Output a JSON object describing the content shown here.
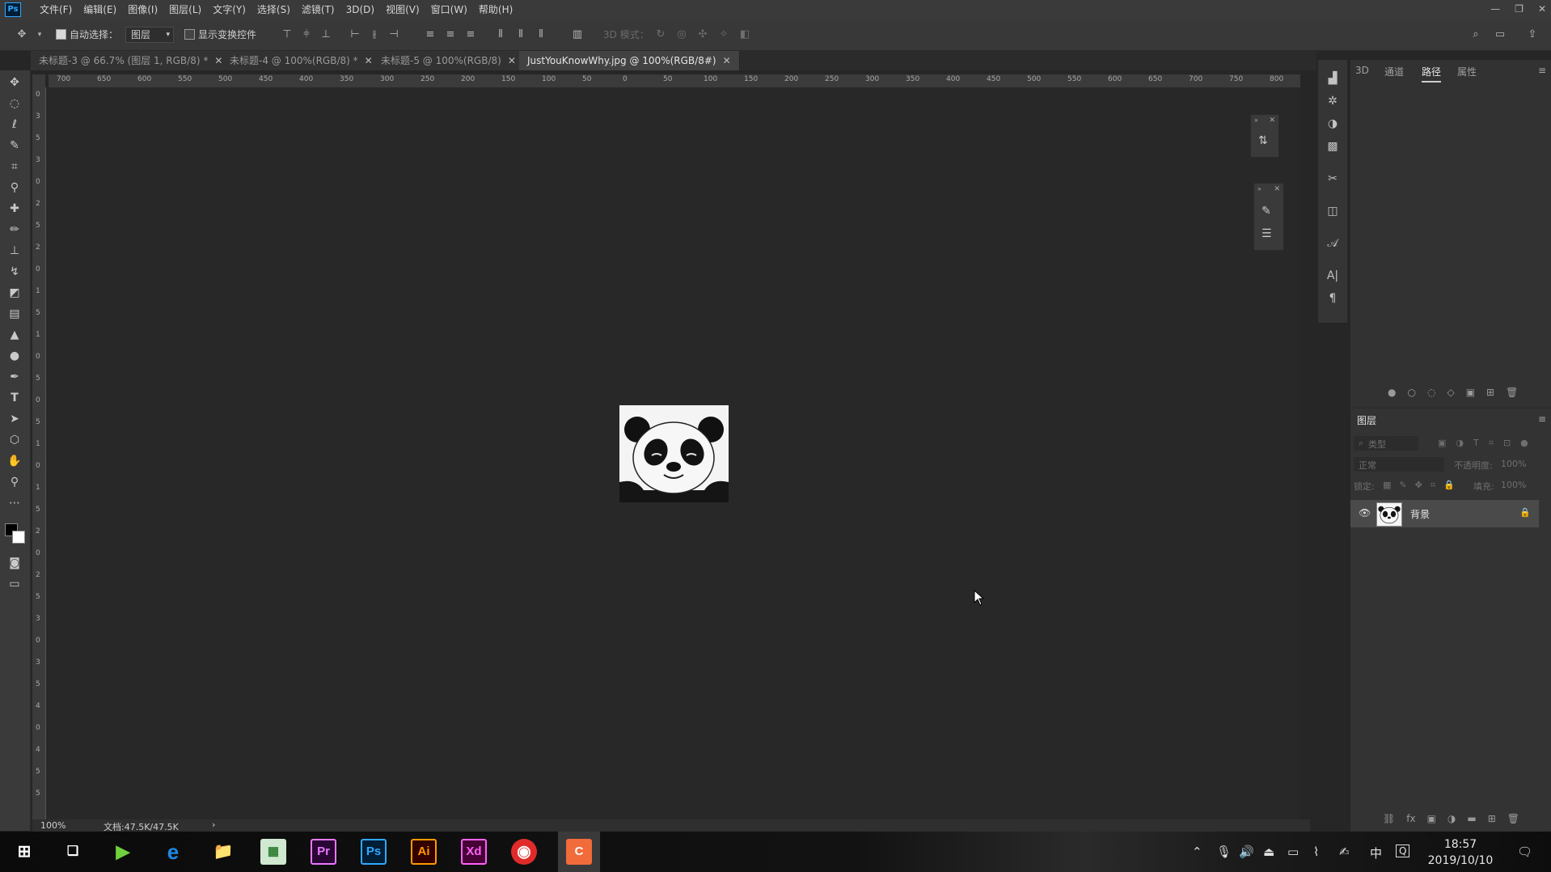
{
  "menubar": {
    "logo": "Ps",
    "items": [
      "文件(F)",
      "编辑(E)",
      "图像(I)",
      "图层(L)",
      "文字(Y)",
      "选择(S)",
      "滤镜(T)",
      "3D(D)",
      "视图(V)",
      "窗口(W)",
      "帮助(H)"
    ],
    "controls": [
      "—",
      "❐",
      "✕"
    ]
  },
  "options": {
    "auto_select_label": "自动选择：",
    "auto_select_checked": true,
    "auto_select_target": "图层",
    "show_transform_label": "显示变换控件",
    "show_transform_checked": false,
    "mode3d_label": "3D 模式："
  },
  "tabs": [
    {
      "label": "未标题-3 @ 66.7% (图层 1, RGB/8) *",
      "active": false
    },
    {
      "label": "未标题-4 @ 100%(RGB/8) *",
      "active": false
    },
    {
      "label": "未标题-5 @ 100%(RGB/8)",
      "active": false
    },
    {
      "label": "JustYouKnowWhy.jpg @ 100%(RGB/8#)",
      "active": true
    }
  ],
  "ruler": {
    "h_ticks": [
      "700",
      "650",
      "600",
      "550",
      "500",
      "450",
      "400",
      "350",
      "300",
      "250",
      "200",
      "150",
      "100",
      "50",
      "0",
      "50",
      "100",
      "150",
      "200",
      "250",
      "300",
      "350",
      "400",
      "450",
      "500",
      "550",
      "600",
      "650",
      "700",
      "750",
      "800"
    ],
    "v_ticks": [
      "0",
      "3",
      "5",
      "3",
      "0",
      "2",
      "5",
      "2",
      "0",
      "1",
      "5",
      "1",
      "0",
      "5",
      "0",
      "5",
      "1",
      "0",
      "1",
      "5",
      "2",
      "0",
      "2",
      "5",
      "3",
      "0",
      "3",
      "5",
      "4",
      "0",
      "4",
      "5",
      "5"
    ]
  },
  "status": {
    "zoom": "100%",
    "doc": "文档:47.5K/47.5K",
    "arrow": "›"
  },
  "right_panel": {
    "tabs": [
      "3D",
      "通道",
      "路径",
      "属性"
    ],
    "active_tab": "路径",
    "layers_title": "图层",
    "search_placeholder": "类型",
    "blend_mode": "正常",
    "opacity_label": "不透明度:",
    "opacity_value": "100%",
    "lock_label": "锁定:",
    "fill_label": "填充:",
    "fill_value": "100%",
    "layer_name": "背景"
  },
  "taskbar": {
    "apps": [
      {
        "name": "start",
        "label": "⊞"
      },
      {
        "name": "task-view",
        "label": "❏"
      },
      {
        "name": "media-player",
        "label": "▶"
      },
      {
        "name": "edge",
        "label": "e"
      },
      {
        "name": "file-explorer",
        "label": "📁"
      },
      {
        "name": "maps",
        "label": "▦"
      },
      {
        "name": "premiere",
        "label": "Pr"
      },
      {
        "name": "photoshop",
        "label": "Ps"
      },
      {
        "name": "illustrator",
        "label": "Ai"
      },
      {
        "name": "xd",
        "label": "Xd"
      },
      {
        "name": "netease-music",
        "label": "◉"
      },
      {
        "name": "app-orange",
        "label": "C"
      }
    ],
    "time": "18:57",
    "date": "2019/10/10",
    "ime": "中"
  }
}
